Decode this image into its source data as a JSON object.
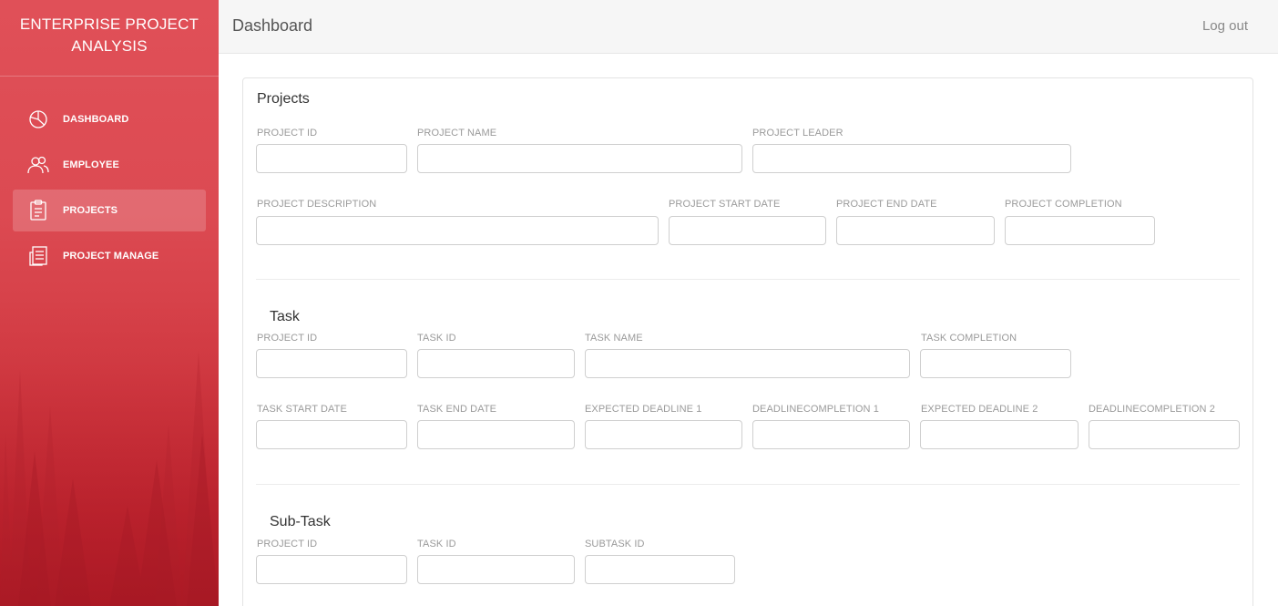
{
  "app": {
    "brand_line1": "ENTERPRISE PROJECT",
    "brand_line2": "ANALYSIS"
  },
  "sidebar": {
    "items": [
      {
        "label": "DASHBOARD",
        "icon": "pie-chart-icon",
        "active": false
      },
      {
        "label": "EMPLOYEE",
        "icon": "users-icon",
        "active": false
      },
      {
        "label": "PROJECTS",
        "icon": "clipboard-icon",
        "active": true
      },
      {
        "label": "PROJECT MANAGE",
        "icon": "document-stack-icon",
        "active": false
      }
    ]
  },
  "header": {
    "title": "Dashboard",
    "logout": "Log out"
  },
  "projects": {
    "title": "Projects",
    "project_id": "PROJECT ID",
    "project_name": "PROJECT NAME",
    "project_leader": "PROJECT LEADER",
    "project_description": "PROJECT DESCRIPTION",
    "project_start_date": "PROJECT START DATE",
    "project_end_date": "PROJECT END DATE",
    "project_completion": "PROJECT COMPLETION"
  },
  "task": {
    "title": "Task",
    "project_id": "PROJECT ID",
    "task_id": "TASK ID",
    "task_name": "TASK NAME",
    "task_completion": "TASK COMPLETION",
    "task_start_date": "TASK START DATE",
    "task_end_date": "TASK END DATE",
    "expected_deadline_1": "EXPECTED DEADLINE 1",
    "deadline_completion_1": "DEADLINECOMPLETION 1",
    "expected_deadline_2": "EXPECTED DEADLINE 2",
    "deadline_completion_2": "DEADLINECOMPLETION 2"
  },
  "subtask": {
    "title": "Sub-Task",
    "project_id": "PROJECT ID",
    "task_id": "TASK ID",
    "subtask_id": "SUBTASK ID"
  },
  "colors": {
    "sidebar_top": "#e05058",
    "sidebar_bottom": "#b81e2a",
    "topbar_bg": "#f6f6f6"
  }
}
